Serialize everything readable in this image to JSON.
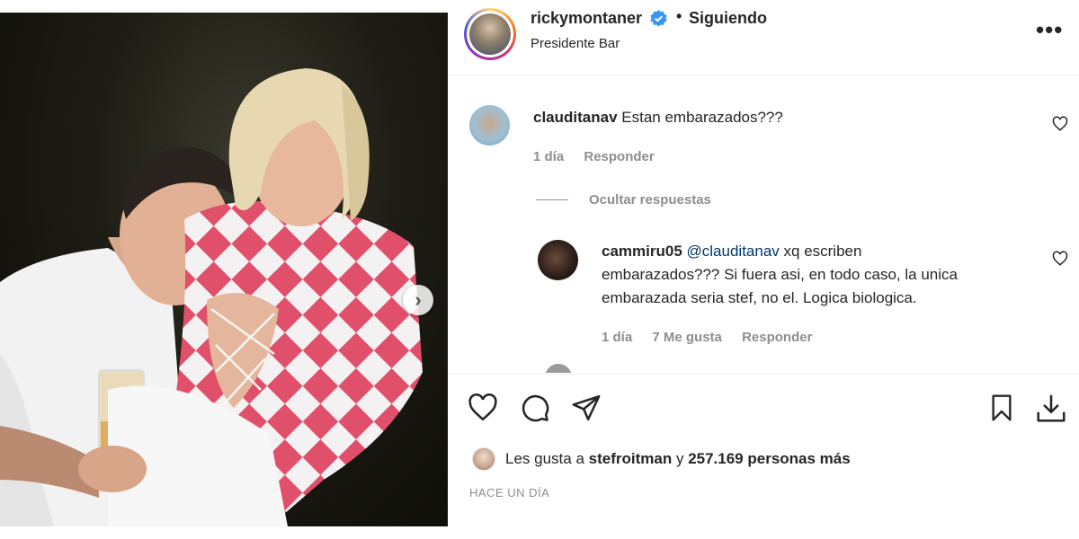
{
  "post": {
    "username": "rickymontaner",
    "follow_status": "Siguiendo",
    "separator": "•",
    "location": "Presidente Bar",
    "more_menu": "•••"
  },
  "comments": [
    {
      "username": "clauditanav",
      "text": "Estan embarazados???",
      "time": "1 día",
      "reply": "Responder"
    }
  ],
  "hide_replies": "Ocultar respuestas",
  "replies": [
    {
      "username": "cammiru05",
      "mention": "@clauditanav",
      "line1": "xq escriben",
      "line2": "embarazados??? Si fuera asi, en todo caso, la unica",
      "line3": "embarazada seria stef, no el. Logica biologica.",
      "time": "1 día",
      "likes": "7 Me gusta",
      "reply": "Responder"
    }
  ],
  "likes": {
    "prefix": "Les gusta a",
    "user": "stefroitman",
    "connector": "y",
    "count": "257.169 personas más"
  },
  "timestamp": "HACE UN DÍA",
  "icons": {
    "verified": "verified-badge-icon",
    "like": "heart-icon",
    "comment": "comment-bubble-icon",
    "share": "paper-plane-icon",
    "save": "bookmark-icon",
    "download": "download-icon",
    "next": "chevron-right-icon"
  },
  "colors": {
    "verified_blue": "#3897f0",
    "meta_gray": "#8e8e8e",
    "text": "#262626",
    "dress_pink": "#e0506a"
  }
}
